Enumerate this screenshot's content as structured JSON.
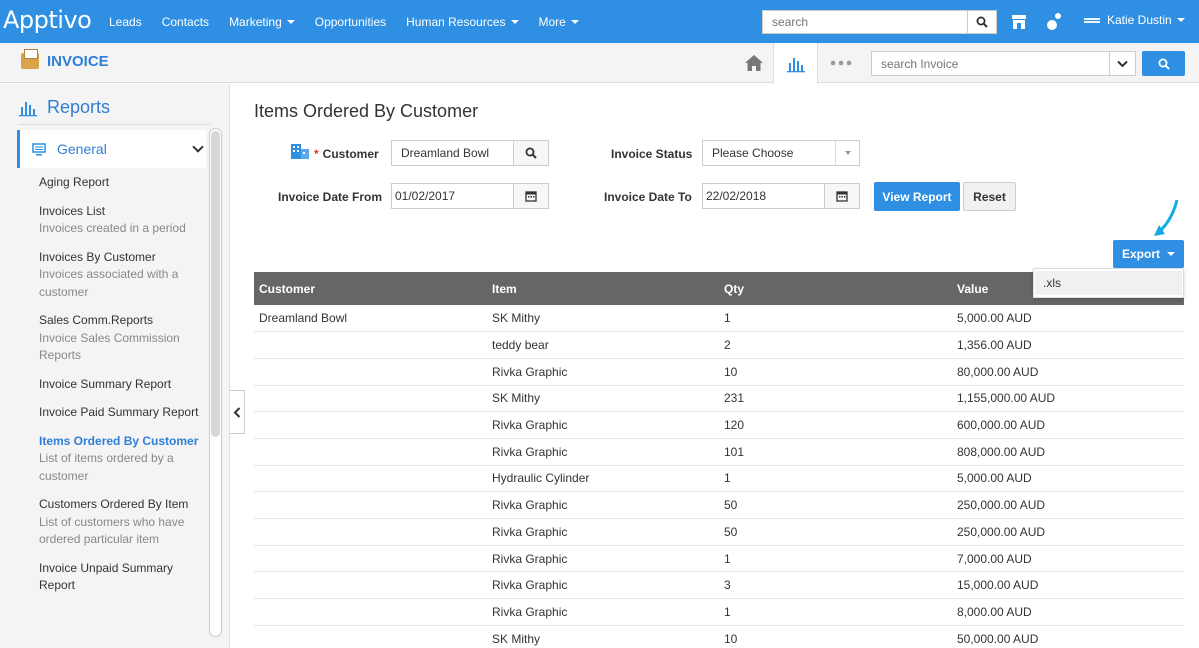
{
  "topnav": {
    "logo": "Apptivo",
    "links": [
      {
        "label": "Leads",
        "dropdown": false
      },
      {
        "label": "Contacts",
        "dropdown": false
      },
      {
        "label": "Marketing",
        "dropdown": true
      },
      {
        "label": "Opportunities",
        "dropdown": false
      },
      {
        "label": "Human Resources",
        "dropdown": true
      },
      {
        "label": "More",
        "dropdown": true
      }
    ],
    "search_placeholder": "search",
    "user_name": "Katie Dustin"
  },
  "app_header": {
    "title": "INVOICE",
    "search_placeholder": "search Invoice"
  },
  "sidebar": {
    "title": "Reports",
    "section": "General",
    "items": [
      {
        "title": "Aging Report",
        "desc": ""
      },
      {
        "title": "Invoices List",
        "desc": "Invoices created in a period"
      },
      {
        "title": "Invoices By Customer",
        "desc": "Invoices associated with a customer"
      },
      {
        "title": "Sales Comm.Reports",
        "desc": "Invoice Sales Commission Reports"
      },
      {
        "title": "Invoice Summary Report",
        "desc": ""
      },
      {
        "title": "Invoice Paid Summary Report",
        "desc": ""
      },
      {
        "title": "Items Ordered By Customer",
        "desc": "List of items ordered by a customer",
        "active": true
      },
      {
        "title": "Customers Ordered By Item",
        "desc": "List of customers who have ordered particular item"
      },
      {
        "title": "Invoice Unpaid Summary Report",
        "desc": ""
      }
    ]
  },
  "report": {
    "title": "Items Ordered By Customer",
    "filters": {
      "customer_label": "Customer",
      "customer_required": "*",
      "customer_value": "Dreamland Bowl",
      "status_label": "Invoice Status",
      "status_value": "Please Choose",
      "date_from_label": "Invoice Date From",
      "date_from_value": "01/02/2017",
      "date_to_label": "Invoice Date To",
      "date_to_value": "22/02/2018"
    },
    "view_report_label": "View Report",
    "reset_label": "Reset",
    "export_label": "Export",
    "export_options": [
      ".xls"
    ],
    "columns": [
      "Customer",
      "Item",
      "Qty",
      "Value"
    ],
    "rows": [
      [
        "Dreamland Bowl",
        "SK Mithy",
        "1",
        "5,000.00 AUD"
      ],
      [
        "",
        "teddy bear",
        "2",
        "1,356.00 AUD"
      ],
      [
        "",
        "Rivka Graphic",
        "10",
        "80,000.00 AUD"
      ],
      [
        "",
        "SK Mithy",
        "231",
        "1,155,000.00 AUD"
      ],
      [
        "",
        "Rivka Graphic",
        "120",
        "600,000.00 AUD"
      ],
      [
        "",
        "Rivka Graphic",
        "101",
        "808,000.00 AUD"
      ],
      [
        "",
        "Hydraulic Cylinder",
        "1",
        "5,000.00 AUD"
      ],
      [
        "",
        "Rivka Graphic",
        "50",
        "250,000.00 AUD"
      ],
      [
        "",
        "Rivka Graphic",
        "50",
        "250,000.00 AUD"
      ],
      [
        "",
        "Rivka Graphic",
        "1",
        "7,000.00 AUD"
      ],
      [
        "",
        "Rivka Graphic",
        "3",
        "15,000.00 AUD"
      ],
      [
        "",
        "Rivka Graphic",
        "1",
        "8,000.00 AUD"
      ],
      [
        "",
        "SK Mithy",
        "10",
        "50,000.00 AUD"
      ]
    ]
  },
  "colors": {
    "brand": "#2f8fe2",
    "header_row": "#666666",
    "arrow": "#17a9e6"
  }
}
